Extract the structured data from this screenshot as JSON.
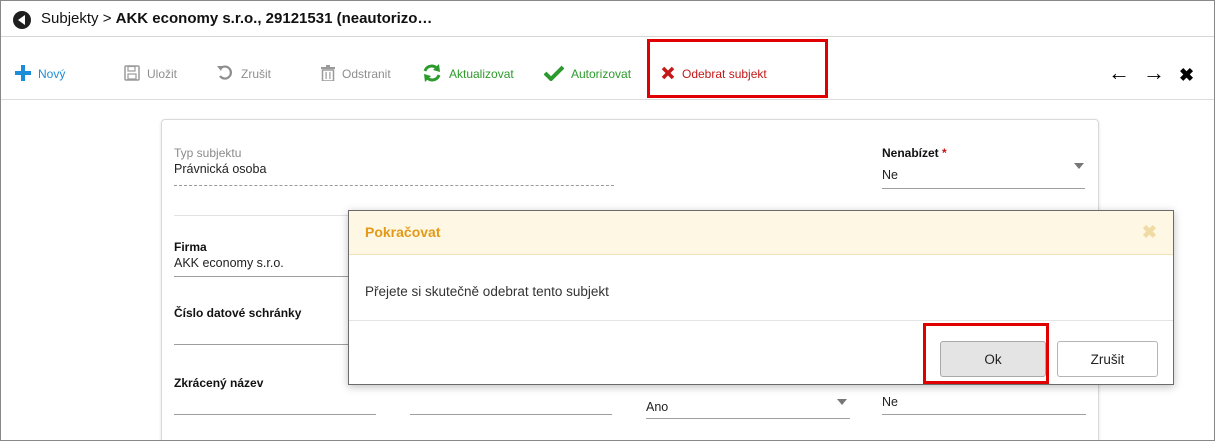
{
  "titlebar": {
    "breadcrumb_prefix": "Subjekty > ",
    "title": "AKK economy s.r.o., 29121531 (neautorizo…"
  },
  "toolbar": {
    "new_label": "Nový",
    "save_label": "Uložit",
    "cancel_label": "Zrušit",
    "delete_label": "Odstranit",
    "refresh_label": "Aktualizovat",
    "authorize_label": "Autorizovat",
    "remove_label": "Odebrat subjekt",
    "back_glyph": "←",
    "forward_glyph": "→",
    "close_glyph": "✖"
  },
  "form": {
    "subject_type_label": "Typ subjektu",
    "subject_type_value": "Právnická osoba",
    "nenabizet_label": "Nenabízet",
    "required_marker": "*",
    "nenabizet_value": "Ne",
    "firma_label": "Firma",
    "firma_value": "AKK economy s.r.o.",
    "datova_schranka_label": "Číslo datové schránky",
    "zkraceny_nazev_label": "Zkrácený název",
    "bottom_select_value": "Ano",
    "bottom_right_value": "Ne"
  },
  "modal": {
    "title": "Pokračovat",
    "close_glyph": "✖",
    "message": "Přejete si skutečně odebrat tento subjekt",
    "ok_label": "Ok",
    "cancel_label": "Zrušit"
  },
  "colors": {
    "accent_blue": "#1c8dd6",
    "success_green": "#2c9a2c",
    "danger_red": "#c41818",
    "highlight_red": "#e00000",
    "modal_title_orange": "#e39a18",
    "modal_header_bg": "#fdf7e3"
  },
  "icons": {
    "logo": "app-logo-icon",
    "new": "plus-icon",
    "save": "floppy-disk-icon",
    "cancel": "undo-icon",
    "delete": "trash-icon",
    "refresh": "refresh-icon",
    "authorize": "checkmark-icon",
    "remove": "x-mark-icon"
  }
}
